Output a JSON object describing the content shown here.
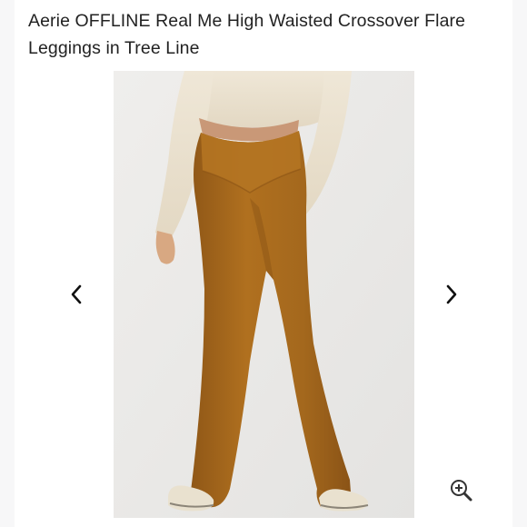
{
  "product": {
    "title": "Aerie OFFLINE Real Me High Waisted Crossover Flare Leggings in Tree Line"
  },
  "gallery": {
    "image_alt": "Aerie OFFLINE Real Me High Waisted Crossover Flare Leggings in Tree Line",
    "prev_icon": "chevron-left-icon",
    "next_icon": "chevron-right-icon",
    "zoom_icon": "zoom-in-icon"
  },
  "colors": {
    "title_text": "#222222",
    "legging": "#a8691f",
    "sweater": "#ece3d2",
    "background": "#ecebe9",
    "link_accent": "#3b3bb5"
  }
}
